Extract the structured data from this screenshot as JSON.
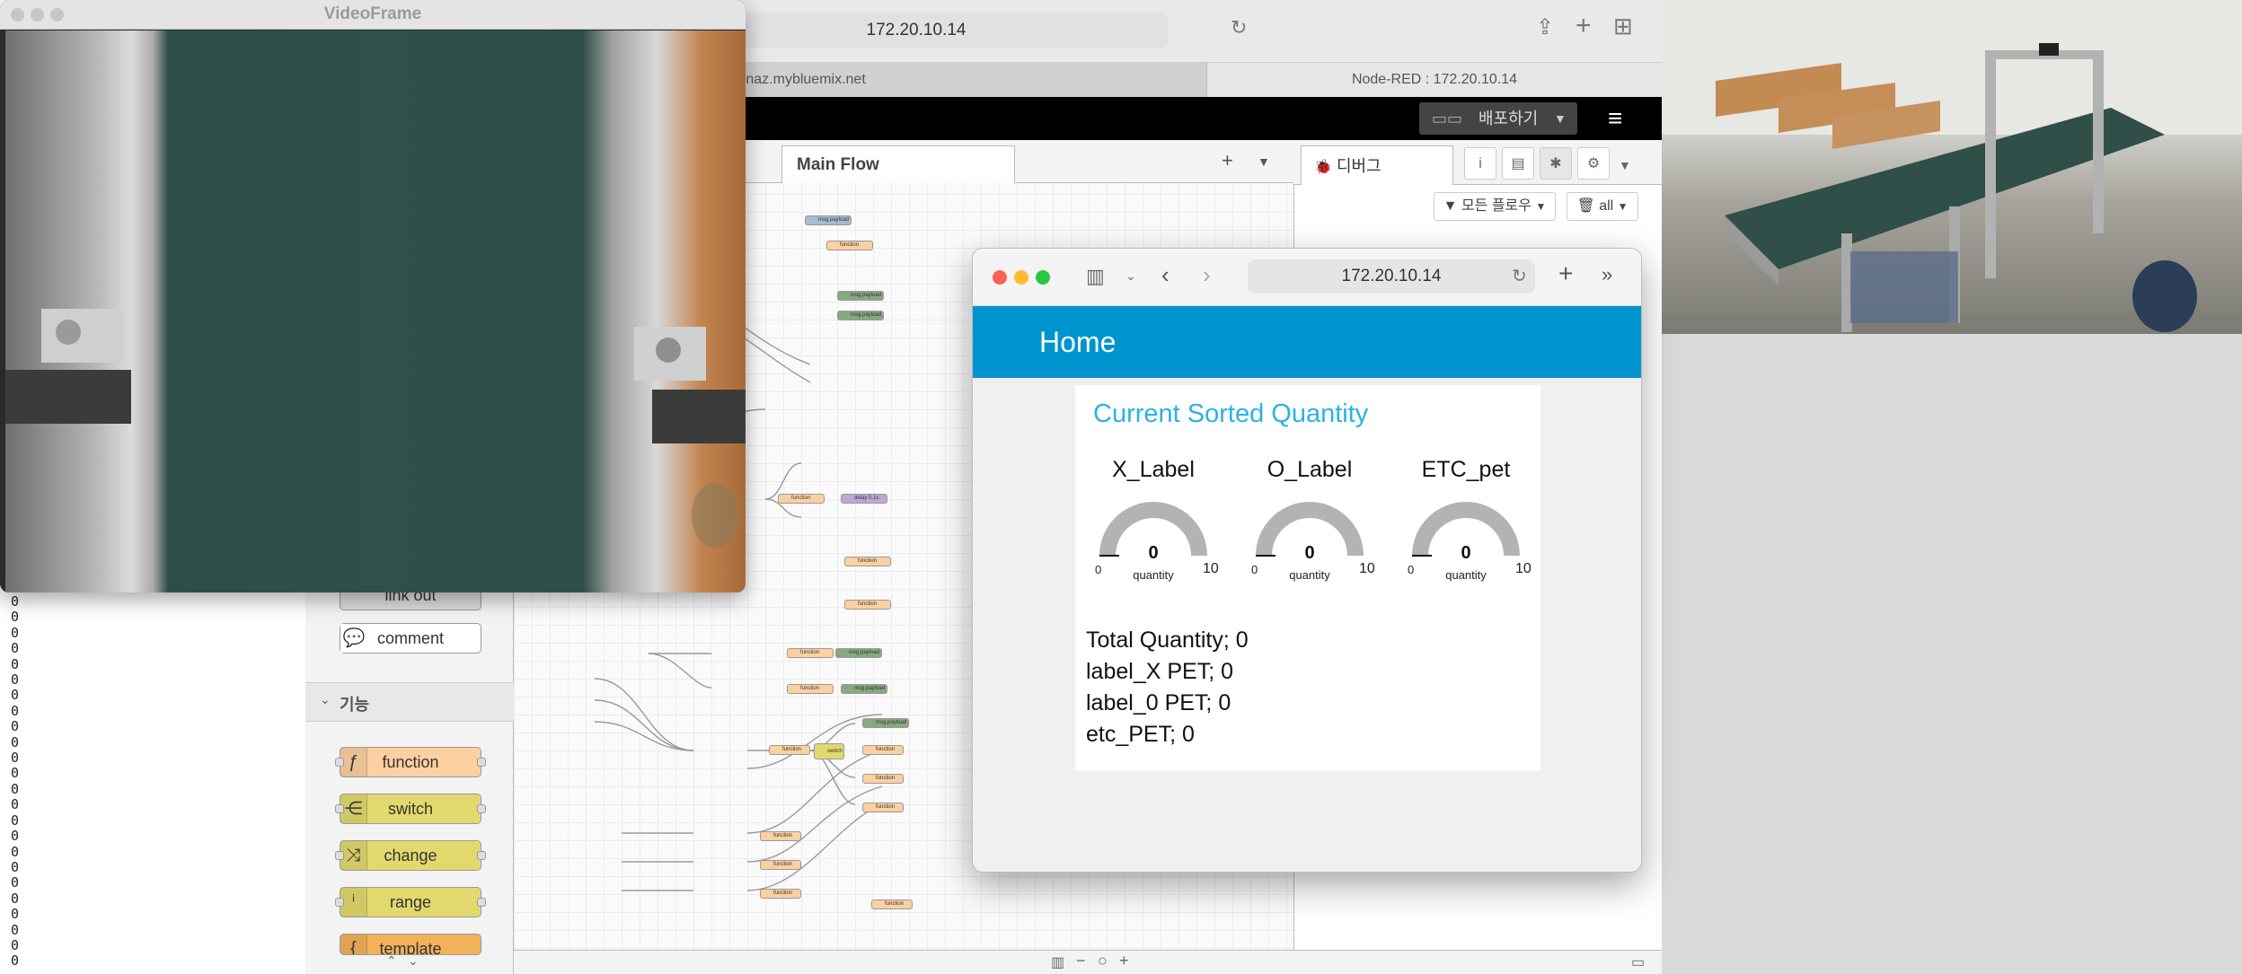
{
  "terminal": {
    "zeros": "0\n0\n0\n0\n0\n0\n0\n0\n0\n0\n0\n0\n0\n0\n0\n0\n0\n0\n0\n0\n0\n0\n0\n0"
  },
  "safari_main": {
    "address": "172.20.10.14",
    "tabs": [
      "Node-RED : wonaz.mybluemix.net",
      "Node-RED : 172.20.10.14"
    ]
  },
  "nodered": {
    "deploy_label": "배포하기",
    "flow_tab": "Main Flow",
    "debug_tab": "디버그",
    "filter_label": "모든 플로우",
    "all_label": "all",
    "palette": {
      "link_out": "link out",
      "comment": "comment",
      "category": "기능",
      "nodes": [
        "function",
        "switch",
        "change",
        "range",
        "template"
      ]
    },
    "flow_nodes": {
      "msg_payload": "msg.payload",
      "function": "function",
      "switch": "switch",
      "delay": "delay 0.1s"
    }
  },
  "video": {
    "title": "VideoFrame"
  },
  "dashboard": {
    "address": "172.20.10.14",
    "header": "Home",
    "card_title": "Current Sorted Quantity",
    "gauges": [
      {
        "label": "X_Label",
        "value": "0",
        "unit": "quantity",
        "min": "0",
        "max": "10",
        "level": 0
      },
      {
        "label": "O_Label",
        "value": "0",
        "unit": "quantity",
        "min": "0",
        "max": "10",
        "level": 0
      },
      {
        "label": "ETC_pet",
        "value": "0",
        "unit": "quantity",
        "min": "0",
        "max": "10",
        "level": 0
      }
    ],
    "stats": [
      "Total Quantity; 0",
      "label_X PET; 0",
      "label_0 PET; 0",
      "etc_PET; 0"
    ]
  },
  "colors": {
    "accent": "#0094ce",
    "title_blue": "#2ab2e7",
    "gauge_track": "#b3b3b3"
  }
}
